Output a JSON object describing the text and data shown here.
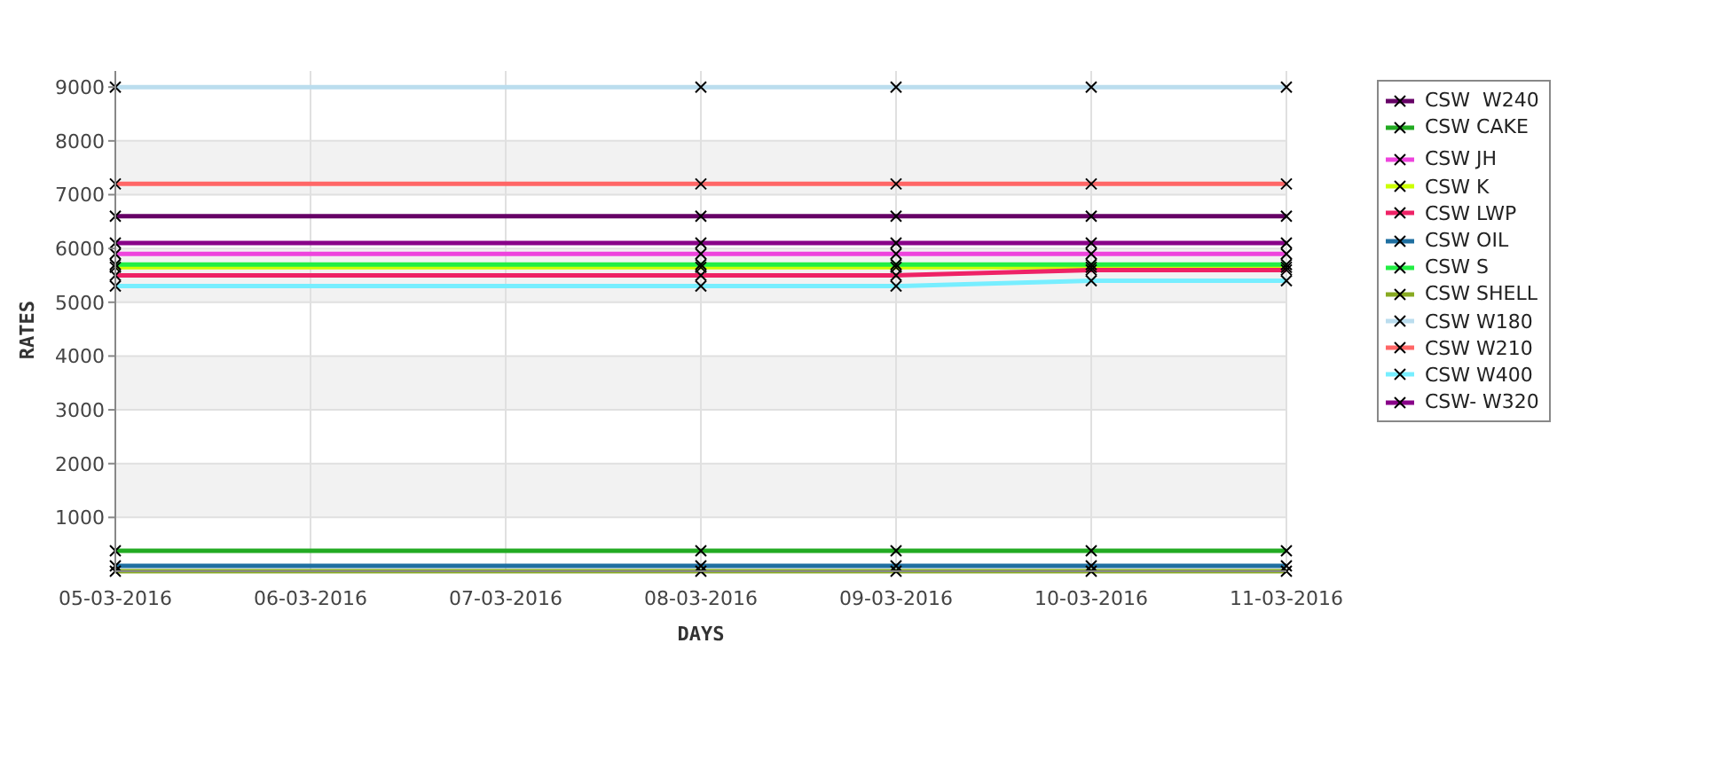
{
  "chart": {
    "chart_data": {
      "type": "line",
      "xlabel": "DAYS",
      "ylabel": "RATES",
      "grid": true,
      "categories": [
        "05-03-2016",
        "06-03-2016",
        "07-03-2016",
        "08-03-2016",
        "09-03-2016",
        "10-03-2016",
        "11-03-2016"
      ],
      "ylim": [
        0,
        9300
      ],
      "yticks": [
        1000,
        2000,
        3000,
        4000,
        5000,
        6000,
        7000,
        8000,
        9000
      ],
      "series": [
        {
          "name": "CSW  W240",
          "color": "#660066",
          "marker": "cross",
          "values": [
            6600,
            null,
            null,
            6600,
            6600,
            6600,
            6600
          ]
        },
        {
          "name": "CSW CAKE",
          "color": "#22aa22",
          "marker": "cross",
          "values": [
            380,
            null,
            null,
            380,
            380,
            380,
            380
          ]
        },
        {
          "name": "CSW JH",
          "color": "#ee44dd",
          "marker": "cross",
          "values": [
            5900,
            null,
            null,
            5900,
            5900,
            5900,
            5900
          ]
        },
        {
          "name": "CSW K",
          "color": "#ccff00",
          "marker": "cross",
          "values": [
            5650,
            null,
            null,
            5650,
            5650,
            5650,
            5650
          ]
        },
        {
          "name": "CSW LWP",
          "color": "#ee2266",
          "marker": "cross",
          "values": [
            5500,
            null,
            null,
            5500,
            5500,
            5600,
            5600
          ]
        },
        {
          "name": "CSW OIL",
          "color": "#1f6fa0",
          "marker": "cross",
          "values": [
            100,
            null,
            null,
            100,
            100,
            100,
            100
          ]
        },
        {
          "name": "CSW S",
          "color": "#22ee44",
          "marker": "cross",
          "values": [
            5700,
            null,
            null,
            5700,
            5700,
            5700,
            5700
          ]
        },
        {
          "name": "CSW SHELL",
          "color": "#88aa22",
          "marker": "cross",
          "values": [
            0,
            null,
            null,
            0,
            0,
            0,
            0
          ]
        },
        {
          "name": "CSW W180",
          "color": "#bbddee",
          "marker": "cross",
          "values": [
            9000,
            null,
            null,
            9000,
            9000,
            9000,
            9000
          ]
        },
        {
          "name": "CSW W210",
          "color": "#ff6666",
          "marker": "cross",
          "values": [
            7200,
            null,
            null,
            7200,
            7200,
            7200,
            7200
          ]
        },
        {
          "name": "CSW W400",
          "color": "#77eeff",
          "marker": "cross",
          "values": [
            5300,
            null,
            null,
            5300,
            5300,
            5400,
            5400
          ]
        },
        {
          "name": "CSW- W320",
          "color": "#880088",
          "marker": "cross",
          "values": [
            6100,
            null,
            null,
            6100,
            6100,
            6100,
            6100
          ]
        }
      ]
    }
  }
}
